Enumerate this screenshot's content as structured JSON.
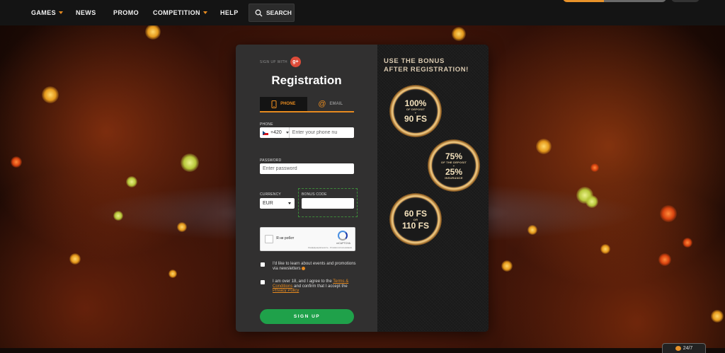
{
  "nav": {
    "items": [
      {
        "label": "GAMES",
        "dropdown": true
      },
      {
        "label": "NEWS",
        "dropdown": false
      },
      {
        "label": "PROMO",
        "dropdown": false
      },
      {
        "label": "COMPETITION",
        "dropdown": true
      },
      {
        "label": "HELP",
        "dropdown": false
      }
    ],
    "search_label": "SEARCH"
  },
  "registration": {
    "signup_with": "SIGN UP WITH",
    "gplus": "g+",
    "title": "Registration",
    "tabs": [
      {
        "label": "PHONE",
        "active": true,
        "icon": "phone-icon"
      },
      {
        "label": "EMAIL",
        "active": false,
        "icon": "at-icon"
      }
    ],
    "phone": {
      "label": "PHONE",
      "country_code": "+420",
      "placeholder": "Enter your phone nu"
    },
    "password": {
      "label": "PASSWORD",
      "placeholder": "Enter password"
    },
    "currency": {
      "label": "CURRENCY",
      "value": "EUR"
    },
    "bonus_code": {
      "label": "BONUS CODE",
      "value": ""
    },
    "captcha": {
      "text": "Я не робот",
      "brand": "reCAPTCHA",
      "privacy": "Конфиденциальность - Условия использования"
    },
    "newsletter": {
      "checked": false,
      "text": "I'd like to learn about events and promotions via newsletters"
    },
    "terms": {
      "checked": false,
      "text_before": "I am over 18, and I agree to the",
      "terms_link": "Terms & Conditions",
      "text_middle": "and confirm that I accept the",
      "privacy_link": "Privacy Policy"
    },
    "submit_label": "SIGN UP"
  },
  "promo": {
    "headline_line1": "USE THE BONUS",
    "headline_line2": "AFTER REGISTRATION!",
    "coins": [
      {
        "big1": "100%",
        "small1": "OF DEPOSIT",
        "small2": "+",
        "big2": "90 FS"
      },
      {
        "big1": "75%",
        "small1": "OF THE DEPOSIT",
        "small2": "+",
        "big2": "25%",
        "small3": "INSURANCE"
      },
      {
        "big1": "60 FS",
        "small1": "OR",
        "big2": "110 FS"
      }
    ]
  },
  "support": {
    "label": "24/7"
  },
  "colors": {
    "accent": "#e68a1f",
    "submit": "#1fa14a",
    "panel": "#313030"
  }
}
